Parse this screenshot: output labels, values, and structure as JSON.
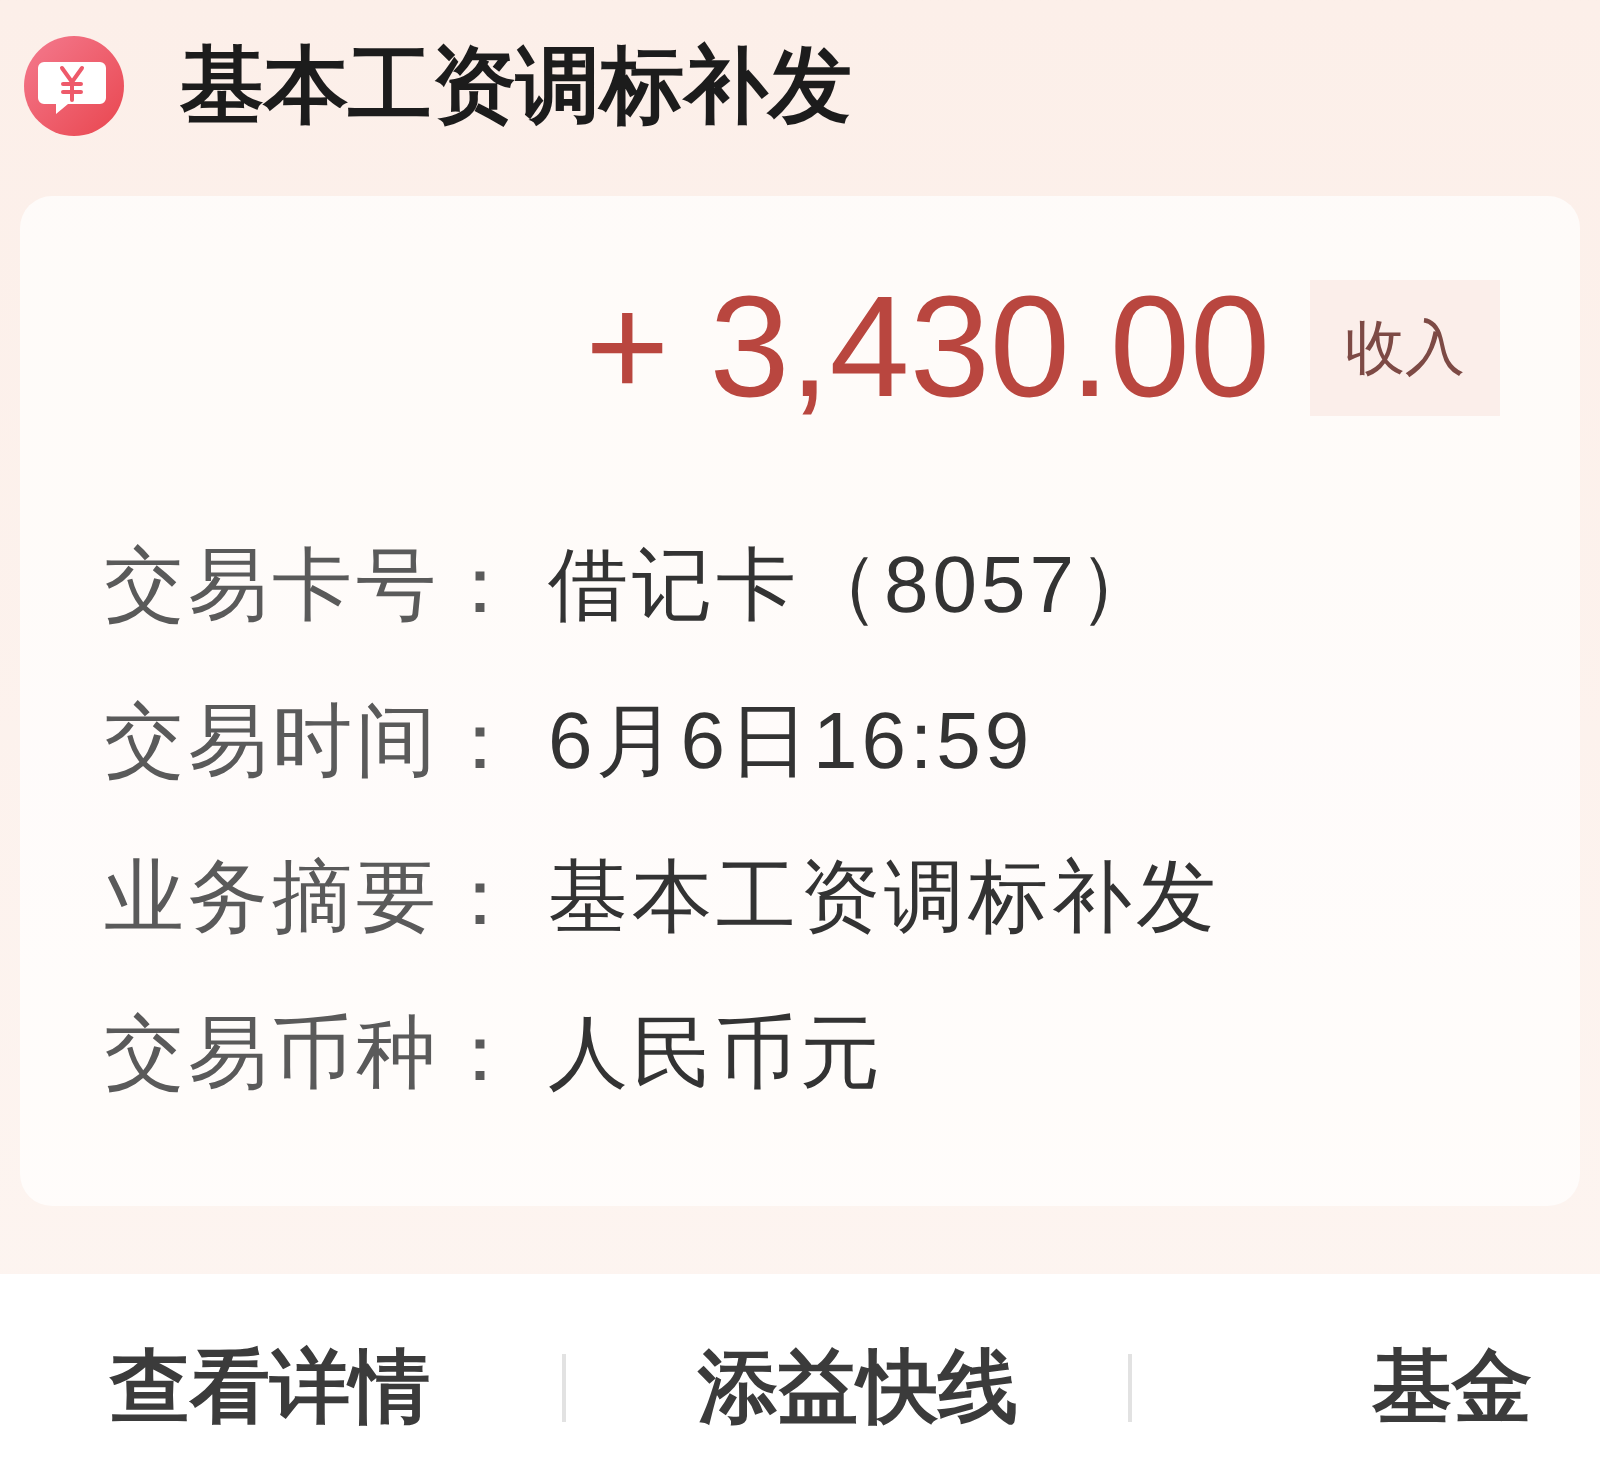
{
  "header": {
    "title": "基本工资调标补发"
  },
  "transaction": {
    "amount": "+ 3,430.00",
    "badge": "收入"
  },
  "details": [
    {
      "label": "交易卡号：",
      "value": "借记卡（8057）"
    },
    {
      "label": "交易时间：",
      "value": "6月6日16:59"
    },
    {
      "label": "业务摘要：",
      "value": "基本工资调标补发"
    },
    {
      "label": "交易币种：",
      "value": "人民币元"
    }
  ],
  "bottom_actions": [
    {
      "label": "查看详情"
    },
    {
      "label": "添益快线"
    },
    {
      "label": "基金"
    }
  ]
}
